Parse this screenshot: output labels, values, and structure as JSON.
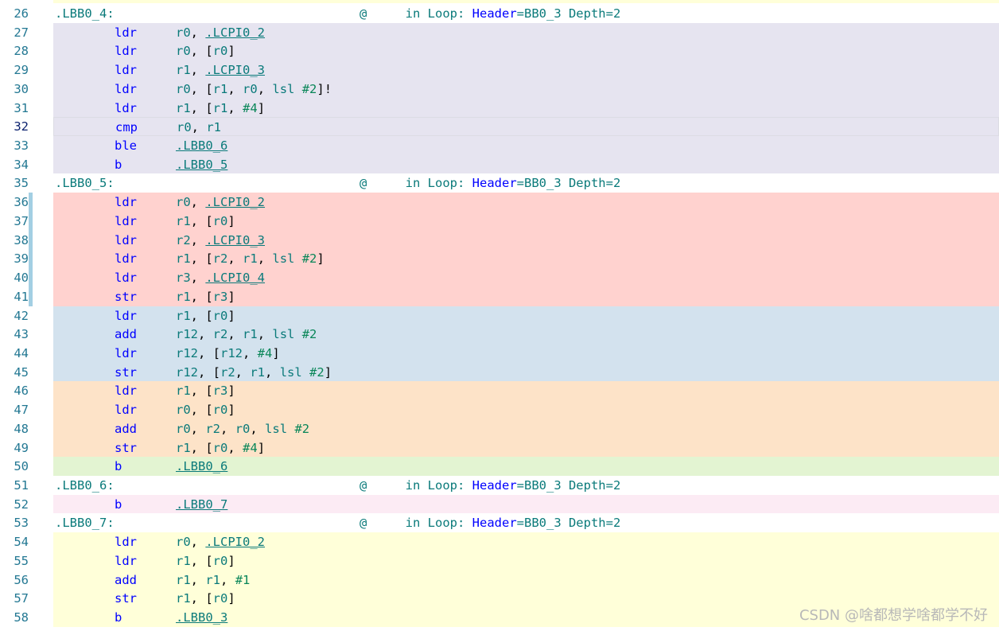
{
  "watermark": "CSDN @啥都想学啥都学不好",
  "colors": {
    "line_number": "#237893",
    "line_number_current": "#0b216f",
    "label": "#0a7a7a",
    "mnemonic": "#0000ff",
    "register": "#0a7a7a",
    "immediate": "#098658",
    "block_lbb0_4": "#e6e4f0",
    "block_red": "#ffd2cf",
    "block_blue": "#d3e2ee",
    "block_orange": "#fde3c8",
    "block_green": "#e3f4d2",
    "block_pink": "#fcebf4",
    "block_yellow": "#ffffd9",
    "gutter_change_marker": "#a3cfe3"
  },
  "lines": [
    {
      "n": "26",
      "type": "label",
      "label": ".LBB0_4:",
      "at": "@",
      "cmt": [
        [
          "t",
          "  in Loop: "
        ],
        [
          "k",
          "Header"
        ],
        [
          "t",
          "=BB0_3 Depth=2"
        ]
      ],
      "bg": "#ffffff"
    },
    {
      "n": "27",
      "type": "instr",
      "mn": "ldr",
      "ops": [
        [
          "r",
          "r0"
        ],
        [
          "p",
          ", "
        ],
        [
          "l",
          ".LCPI0_2"
        ]
      ],
      "bg": "#e6e4f0"
    },
    {
      "n": "28",
      "type": "instr",
      "mn": "ldr",
      "ops": [
        [
          "r",
          "r0"
        ],
        [
          "p",
          ", ["
        ],
        [
          "r",
          "r0"
        ],
        [
          "p",
          "]"
        ]
      ],
      "bg": "#e6e4f0"
    },
    {
      "n": "29",
      "type": "instr",
      "mn": "ldr",
      "ops": [
        [
          "r",
          "r1"
        ],
        [
          "p",
          ", "
        ],
        [
          "l",
          ".LCPI0_3"
        ]
      ],
      "bg": "#e6e4f0"
    },
    {
      "n": "30",
      "type": "instr",
      "mn": "ldr",
      "ops": [
        [
          "r",
          "r0"
        ],
        [
          "p",
          ", ["
        ],
        [
          "r",
          "r1"
        ],
        [
          "p",
          ", "
        ],
        [
          "r",
          "r0"
        ],
        [
          "p",
          ", "
        ],
        [
          "r",
          "lsl"
        ],
        [
          "p",
          " "
        ],
        [
          "i",
          "#2"
        ],
        [
          "p",
          "]!"
        ]
      ],
      "bg": "#e6e4f0"
    },
    {
      "n": "31",
      "type": "instr",
      "mn": "ldr",
      "ops": [
        [
          "r",
          "r1"
        ],
        [
          "p",
          ", ["
        ],
        [
          "r",
          "r1"
        ],
        [
          "p",
          ", "
        ],
        [
          "i",
          "#4"
        ],
        [
          "p",
          "]"
        ]
      ],
      "bg": "#e6e4f0"
    },
    {
      "n": "32",
      "type": "instr",
      "current": true,
      "mn": "cmp",
      "ops": [
        [
          "r",
          "r0"
        ],
        [
          "p",
          ", "
        ],
        [
          "r",
          "r1"
        ]
      ],
      "bg": "#e6e4f0"
    },
    {
      "n": "33",
      "type": "instr",
      "mn": "ble",
      "ops": [
        [
          "l",
          ".LBB0_6"
        ]
      ],
      "bg": "#e6e4f0"
    },
    {
      "n": "34",
      "type": "instr",
      "mn": "b",
      "ops": [
        [
          "l",
          ".LBB0_5"
        ]
      ],
      "bg": "#e6e4f0"
    },
    {
      "n": "35",
      "type": "label",
      "label": ".LBB0_5:",
      "at": "@",
      "cmt": [
        [
          "t",
          "  in Loop: "
        ],
        [
          "k",
          "Header"
        ],
        [
          "t",
          "=BB0_3 Depth=2"
        ]
      ],
      "bg": "#ffffff"
    },
    {
      "n": "36",
      "type": "instr",
      "marker": true,
      "mn": "ldr",
      "ops": [
        [
          "r",
          "r0"
        ],
        [
          "p",
          ", "
        ],
        [
          "l",
          ".LCPI0_2"
        ]
      ],
      "bg": "#ffd2cf"
    },
    {
      "n": "37",
      "type": "instr",
      "marker": true,
      "mn": "ldr",
      "ops": [
        [
          "r",
          "r1"
        ],
        [
          "p",
          ", ["
        ],
        [
          "r",
          "r0"
        ],
        [
          "p",
          "]"
        ]
      ],
      "bg": "#ffd2cf"
    },
    {
      "n": "38",
      "type": "instr",
      "marker": true,
      "mn": "ldr",
      "ops": [
        [
          "r",
          "r2"
        ],
        [
          "p",
          ", "
        ],
        [
          "l",
          ".LCPI0_3"
        ]
      ],
      "bg": "#ffd2cf"
    },
    {
      "n": "39",
      "type": "instr",
      "marker": true,
      "mn": "ldr",
      "ops": [
        [
          "r",
          "r1"
        ],
        [
          "p",
          ", ["
        ],
        [
          "r",
          "r2"
        ],
        [
          "p",
          ", "
        ],
        [
          "r",
          "r1"
        ],
        [
          "p",
          ", "
        ],
        [
          "r",
          "lsl"
        ],
        [
          "p",
          " "
        ],
        [
          "i",
          "#2"
        ],
        [
          "p",
          "]"
        ]
      ],
      "bg": "#ffd2cf"
    },
    {
      "n": "40",
      "type": "instr",
      "marker": true,
      "mn": "ldr",
      "ops": [
        [
          "r",
          "r3"
        ],
        [
          "p",
          ", "
        ],
        [
          "l",
          ".LCPI0_4"
        ]
      ],
      "bg": "#ffd2cf"
    },
    {
      "n": "41",
      "type": "instr",
      "marker": true,
      "mn": "str",
      "ops": [
        [
          "r",
          "r1"
        ],
        [
          "p",
          ", ["
        ],
        [
          "r",
          "r3"
        ],
        [
          "p",
          "]"
        ]
      ],
      "bg": "#ffd2cf"
    },
    {
      "n": "42",
      "type": "instr",
      "mn": "ldr",
      "ops": [
        [
          "r",
          "r1"
        ],
        [
          "p",
          ", ["
        ],
        [
          "r",
          "r0"
        ],
        [
          "p",
          "]"
        ]
      ],
      "bg": "#d3e2ee"
    },
    {
      "n": "43",
      "type": "instr",
      "mn": "add",
      "ops": [
        [
          "r",
          "r12"
        ],
        [
          "p",
          ", "
        ],
        [
          "r",
          "r2"
        ],
        [
          "p",
          ", "
        ],
        [
          "r",
          "r1"
        ],
        [
          "p",
          ", "
        ],
        [
          "r",
          "lsl"
        ],
        [
          "p",
          " "
        ],
        [
          "i",
          "#2"
        ]
      ],
      "bg": "#d3e2ee"
    },
    {
      "n": "44",
      "type": "instr",
      "mn": "ldr",
      "ops": [
        [
          "r",
          "r12"
        ],
        [
          "p",
          ", ["
        ],
        [
          "r",
          "r12"
        ],
        [
          "p",
          ", "
        ],
        [
          "i",
          "#4"
        ],
        [
          "p",
          "]"
        ]
      ],
      "bg": "#d3e2ee"
    },
    {
      "n": "45",
      "type": "instr",
      "mn": "str",
      "ops": [
        [
          "r",
          "r12"
        ],
        [
          "p",
          ", ["
        ],
        [
          "r",
          "r2"
        ],
        [
          "p",
          ", "
        ],
        [
          "r",
          "r1"
        ],
        [
          "p",
          ", "
        ],
        [
          "r",
          "lsl"
        ],
        [
          "p",
          " "
        ],
        [
          "i",
          "#2"
        ],
        [
          "p",
          "]"
        ]
      ],
      "bg": "#d3e2ee"
    },
    {
      "n": "46",
      "type": "instr",
      "mn": "ldr",
      "ops": [
        [
          "r",
          "r1"
        ],
        [
          "p",
          ", ["
        ],
        [
          "r",
          "r3"
        ],
        [
          "p",
          "]"
        ]
      ],
      "bg": "#fde3c8"
    },
    {
      "n": "47",
      "type": "instr",
      "mn": "ldr",
      "ops": [
        [
          "r",
          "r0"
        ],
        [
          "p",
          ", ["
        ],
        [
          "r",
          "r0"
        ],
        [
          "p",
          "]"
        ]
      ],
      "bg": "#fde3c8"
    },
    {
      "n": "48",
      "type": "instr",
      "mn": "add",
      "ops": [
        [
          "r",
          "r0"
        ],
        [
          "p",
          ", "
        ],
        [
          "r",
          "r2"
        ],
        [
          "p",
          ", "
        ],
        [
          "r",
          "r0"
        ],
        [
          "p",
          ", "
        ],
        [
          "r",
          "lsl"
        ],
        [
          "p",
          " "
        ],
        [
          "i",
          "#2"
        ]
      ],
      "bg": "#fde3c8"
    },
    {
      "n": "49",
      "type": "instr",
      "mn": "str",
      "ops": [
        [
          "r",
          "r1"
        ],
        [
          "p",
          ", ["
        ],
        [
          "r",
          "r0"
        ],
        [
          "p",
          ", "
        ],
        [
          "i",
          "#4"
        ],
        [
          "p",
          "]"
        ]
      ],
      "bg": "#fde3c8"
    },
    {
      "n": "50",
      "type": "instr",
      "mn": "b",
      "ops": [
        [
          "l",
          ".LBB0_6"
        ]
      ],
      "bg": "#e3f4d2"
    },
    {
      "n": "51",
      "type": "label",
      "label": ".LBB0_6:",
      "at": "@",
      "cmt": [
        [
          "t",
          "  in Loop: "
        ],
        [
          "k",
          "Header"
        ],
        [
          "t",
          "=BB0_3 Depth=2"
        ]
      ],
      "bg": "#ffffff"
    },
    {
      "n": "52",
      "type": "instr",
      "mn": "b",
      "ops": [
        [
          "l",
          ".LBB0_7"
        ]
      ],
      "bg": "#fcebf4"
    },
    {
      "n": "53",
      "type": "label",
      "label": ".LBB0_7:",
      "at": "@",
      "cmt": [
        [
          "t",
          "  in Loop: "
        ],
        [
          "k",
          "Header"
        ],
        [
          "t",
          "=BB0_3 Depth=2"
        ]
      ],
      "bg": "#ffffff"
    },
    {
      "n": "54",
      "type": "instr",
      "mn": "ldr",
      "ops": [
        [
          "r",
          "r0"
        ],
        [
          "p",
          ", "
        ],
        [
          "l",
          ".LCPI0_2"
        ]
      ],
      "bg": "#ffffd9"
    },
    {
      "n": "55",
      "type": "instr",
      "mn": "ldr",
      "ops": [
        [
          "r",
          "r1"
        ],
        [
          "p",
          ", ["
        ],
        [
          "r",
          "r0"
        ],
        [
          "p",
          "]"
        ]
      ],
      "bg": "#ffffd9"
    },
    {
      "n": "56",
      "type": "instr",
      "mn": "add",
      "ops": [
        [
          "r",
          "r1"
        ],
        [
          "p",
          ", "
        ],
        [
          "r",
          "r1"
        ],
        [
          "p",
          ", "
        ],
        [
          "i",
          "#1"
        ]
      ],
      "bg": "#ffffd9"
    },
    {
      "n": "57",
      "type": "instr",
      "mn": "str",
      "ops": [
        [
          "r",
          "r1"
        ],
        [
          "p",
          ", ["
        ],
        [
          "r",
          "r0"
        ],
        [
          "p",
          "]"
        ]
      ],
      "bg": "#ffffd9"
    },
    {
      "n": "58",
      "type": "instr",
      "mn": "b",
      "ops": [
        [
          "l",
          ".LBB0_3"
        ]
      ],
      "bg": "#ffffd9"
    }
  ]
}
